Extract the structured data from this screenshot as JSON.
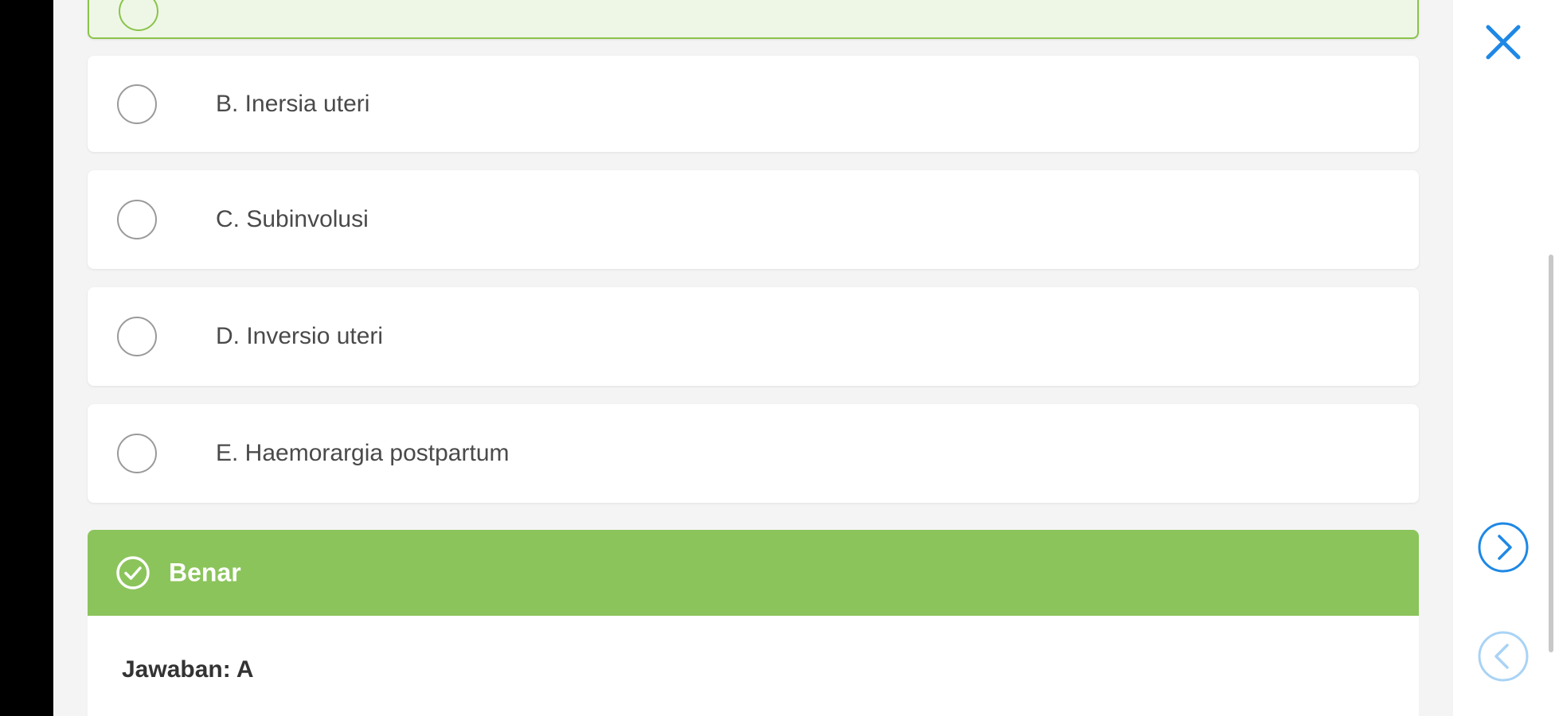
{
  "options": [
    {
      "label": ""
    },
    {
      "label": "B. Inersia uteri"
    },
    {
      "label": "C. Subinvolusi"
    },
    {
      "label": "D. Inversio uteri"
    },
    {
      "label": "E. Haemorargia postpartum"
    }
  ],
  "result": {
    "title": "Benar",
    "answer": "Jawaban: A"
  },
  "colors": {
    "correct_green": "#8bc45b",
    "selected_bg": "#eef7e6",
    "accent_blue": "#1e88e5"
  },
  "icons": {
    "close": "close-icon",
    "next": "chevron-right-circle-icon",
    "prev": "chevron-left-circle-icon",
    "check": "check-circle-icon"
  }
}
